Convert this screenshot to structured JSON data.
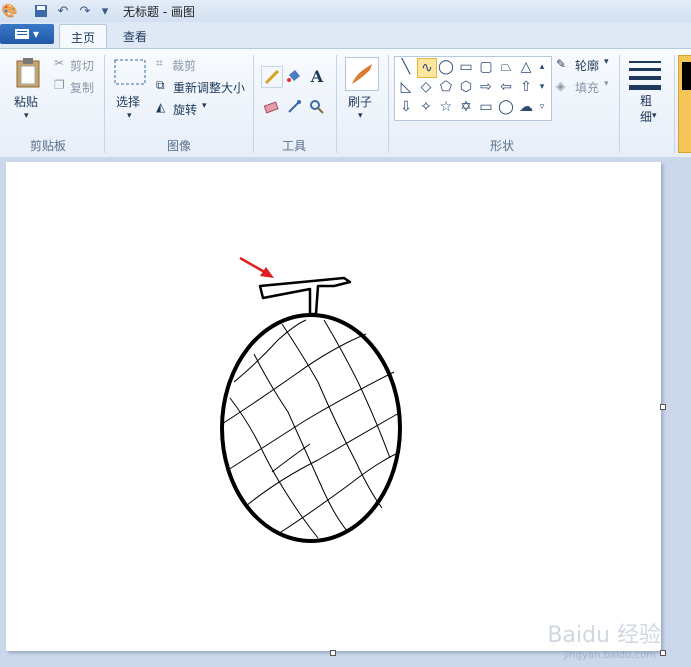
{
  "title": "无标题 - 画图",
  "tabs": {
    "file": "",
    "home": "主页",
    "view": "查看"
  },
  "clipboard": {
    "paste": "粘贴",
    "cut": "剪切",
    "copy": "复制",
    "group": "剪贴板"
  },
  "image": {
    "select": "选择",
    "crop": "裁剪",
    "resize": "重新调整大小",
    "rotate": "旋转",
    "group": "图像"
  },
  "tools": {
    "group": "工具"
  },
  "brushes": {
    "label": "刷子"
  },
  "shapes": {
    "outline": "轮廓",
    "fill": "填充",
    "group": "形状"
  },
  "size": {
    "label": "粗细"
  },
  "colors": {
    "accent": "#1f5aa8",
    "arrow": "#e02020"
  },
  "watermark": {
    "main": "Baidu 经验",
    "sub": "jingyan.baidu.com"
  }
}
